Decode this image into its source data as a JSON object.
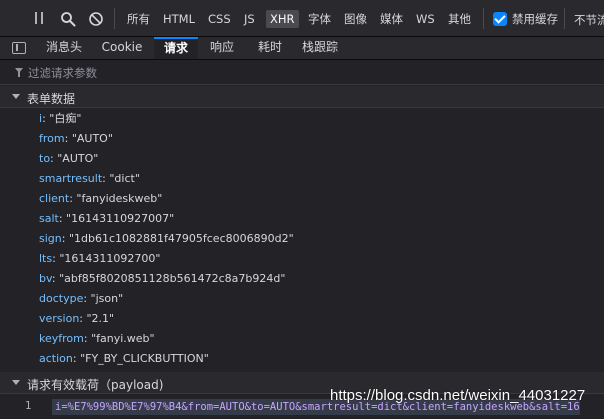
{
  "toolbar": {
    "pause_icon": "pause-icon",
    "search_icon": "search-icon",
    "block_icon": "block-icon",
    "filter_types": [
      "所有",
      "HTML",
      "CSS",
      "JS",
      "XHR",
      "字体",
      "图像",
      "媒体",
      "WS",
      "其他"
    ],
    "active_filter": "XHR",
    "disable_cache_label": "禁用缓存",
    "disable_cache_checked": true,
    "throttle_label": "不节流"
  },
  "tabs": {
    "items": [
      "消息头",
      "Cookie",
      "请求",
      "响应",
      "耗时",
      "栈跟踪"
    ],
    "selected": "请求"
  },
  "filter": {
    "placeholder": "过滤请求参数"
  },
  "form_section": {
    "title": "表单数据",
    "params": [
      {
        "key": "i",
        "value": "\"白痴\""
      },
      {
        "key": "from",
        "value": "\"AUTO\""
      },
      {
        "key": "to",
        "value": "\"AUTO\""
      },
      {
        "key": "smartresult",
        "value": "\"dict\""
      },
      {
        "key": "client",
        "value": "\"fanyideskweb\""
      },
      {
        "key": "salt",
        "value": "\"16143110927007\""
      },
      {
        "key": "sign",
        "value": "\"1db61c1082881f47905fcec8006890d2\""
      },
      {
        "key": "lts",
        "value": "\"1614311092700\""
      },
      {
        "key": "bv",
        "value": "\"abf85f8020851128b561472c8a7b924d\""
      },
      {
        "key": "doctype",
        "value": "\"json\""
      },
      {
        "key": "version",
        "value": "\"2.1\""
      },
      {
        "key": "keyfrom",
        "value": "\"fanyi.web\""
      },
      {
        "key": "action",
        "value": "\"FY_BY_CLICKBUTTION\""
      }
    ]
  },
  "payload_section": {
    "title": "请求有效载荷（payload)",
    "line_number": "1",
    "raw": "i=%E7%99%BD%E7%97%B4&from=AUTO&to=AUTO&smartresult=dict&client=fanyideskweb&salt=16"
  },
  "watermark": "https://blog.csdn.net/weixin_44031227",
  "colors": {
    "accent": "#0a84ff",
    "param_key": "#75bfff",
    "payload_text": "#c7a5ff",
    "background": "#232327"
  }
}
